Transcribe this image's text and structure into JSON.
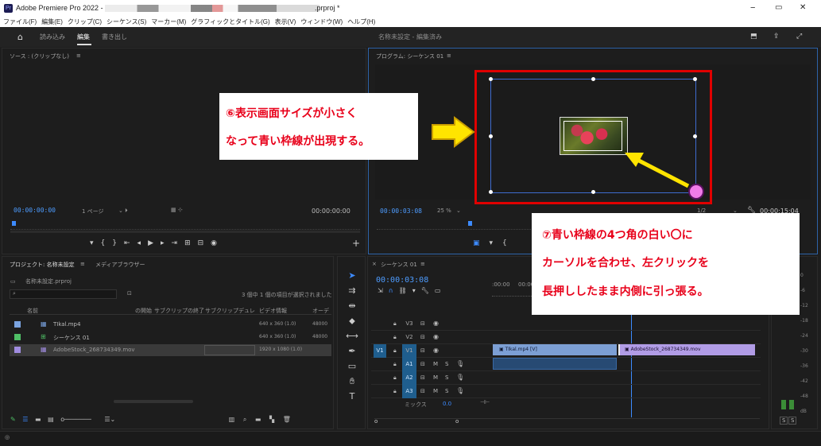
{
  "title_bar": {
    "app_title": "Adobe Premiere Pro 2022 -",
    "file_suffix": ".prproj *",
    "min": "−",
    "restore": "▭",
    "close": "✕"
  },
  "menu": [
    "ファイル(F)",
    "編集(E)",
    "クリップ(C)",
    "シーケンス(S)",
    "マーカー(M)",
    "グラフィックとタイトル(G)",
    "表示(V)",
    "ウィンドウ(W)",
    "ヘルプ(H)"
  ],
  "workspace": {
    "tabs": [
      "読み込み",
      "編集",
      "書き出し"
    ],
    "center": "名称未設定 - 編集済み"
  },
  "source": {
    "title": "ソース : (クリップなし)",
    "timecode_left": "00:00:00:00",
    "page": "1 ページ",
    "timecode_right": "00:00:00:00"
  },
  "program": {
    "title": "プログラム: シーケンス 01",
    "timecode_left": "00:00:03:08",
    "zoom": "25 %",
    "fraction": "1/2",
    "timecode_right": "00:00:15:04"
  },
  "project": {
    "tab_project": "プロジェクト: 名称未設定",
    "tab_media": "メディアブラウザー",
    "file": "名称未設定.prproj",
    "selection_info": "3 個中 1 個の項目が選択されました",
    "columns": [
      "名前",
      "の開始",
      "サブクリップの終了",
      "サブクリップデュレ",
      "ビデオ情報",
      "オーデ"
    ],
    "items": [
      {
        "name": "TIkal.mp4",
        "video": "640 x 360 (1.0)",
        "audio": "48000",
        "color": "#7aa3e0"
      },
      {
        "name": "シーケンス 01",
        "video": "640 x 360 (1.0)",
        "audio": "48000",
        "color": "#4fbf66"
      },
      {
        "name": "AdobeStock_268734349.mov",
        "video": "1920 x 1080 (1.0)",
        "audio": "",
        "color": "#a08ce0"
      }
    ]
  },
  "timeline": {
    "title": "シーケンス 01",
    "timecode": "00:00:03:08",
    "ruler": [
      ":00:00",
      "00:00"
    ],
    "video_tracks": [
      "V3",
      "V2",
      "V1"
    ],
    "v1_source": "V1",
    "audio_tracks": [
      "A1",
      "A2",
      "A3"
    ],
    "mix_label": "ミックス",
    "mix_value": "0.0",
    "clip1": "TIkal.mp4 [V]",
    "clip2": "AdobeStock_268734349.mov"
  },
  "meter": {
    "scale": [
      "0",
      "-6",
      "-12",
      "-18",
      "-24",
      "-30",
      "-36",
      "-42",
      "-48",
      "dB"
    ],
    "solo": [
      "S",
      "S"
    ]
  },
  "callouts": {
    "c6_line1": "⑥表示画面サイズが小さく",
    "c6_line2": "なって青い枠線が出現する。",
    "c7_line1": "⑦青い枠線の4つ角の白い〇に",
    "c7_line2": "カーソルを合わせ、左クリックを",
    "c7_line3": "長押ししたまま内側に引っ張る。"
  }
}
